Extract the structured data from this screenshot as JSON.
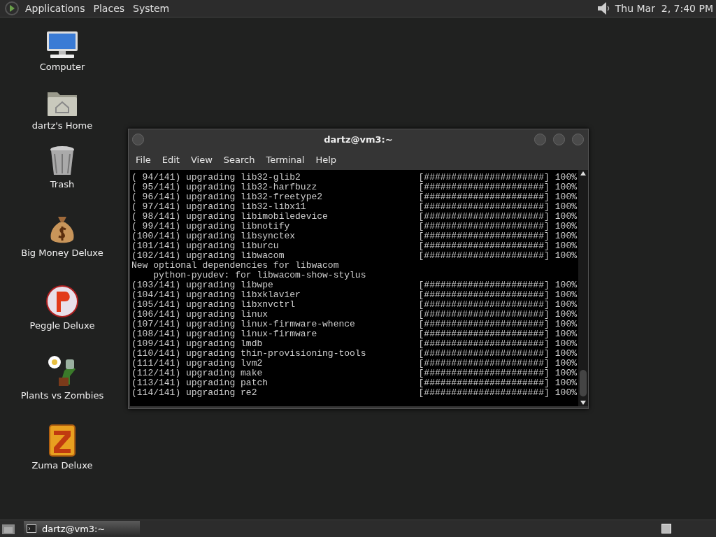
{
  "top_panel": {
    "menus": [
      "Applications",
      "Places",
      "System"
    ],
    "clock": "Thu Mar  2, 7:40 PM"
  },
  "desktop_icons": [
    {
      "kind": "computer",
      "label": "Computer"
    },
    {
      "kind": "home",
      "label": "dartz's Home"
    },
    {
      "kind": "trash",
      "label": "Trash"
    },
    {
      "kind": "money",
      "label": "Big Money Deluxe"
    },
    {
      "kind": "peggle",
      "label": "Peggle Deluxe"
    },
    {
      "kind": "plants",
      "label": "Plants vs Zombies"
    },
    {
      "kind": "zuma",
      "label": "Zuma Deluxe"
    }
  ],
  "window": {
    "title": "dartz@vm3:~",
    "menu": [
      "File",
      "Edit",
      "View",
      "Search",
      "Terminal",
      "Help"
    ],
    "lines": [
      {
        "kind": "progress",
        "text": "( 94/141) upgrading lib32-glib2",
        "bar": "[######################]",
        "percent": "100%"
      },
      {
        "kind": "progress",
        "text": "( 95/141) upgrading lib32-harfbuzz",
        "bar": "[######################]",
        "percent": "100%"
      },
      {
        "kind": "progress",
        "text": "( 96/141) upgrading lib32-freetype2",
        "bar": "[######################]",
        "percent": "100%"
      },
      {
        "kind": "progress",
        "text": "( 97/141) upgrading lib32-libx11",
        "bar": "[######################]",
        "percent": "100%"
      },
      {
        "kind": "progress",
        "text": "( 98/141) upgrading libimobiledevice",
        "bar": "[######################]",
        "percent": "100%"
      },
      {
        "kind": "progress",
        "text": "( 99/141) upgrading libnotify",
        "bar": "[######################]",
        "percent": "100%"
      },
      {
        "kind": "progress",
        "text": "(100/141) upgrading libsynctex",
        "bar": "[######################]",
        "percent": "100%"
      },
      {
        "kind": "progress",
        "text": "(101/141) upgrading liburcu",
        "bar": "[######################]",
        "percent": "100%"
      },
      {
        "kind": "progress",
        "text": "(102/141) upgrading libwacom",
        "bar": "[######################]",
        "percent": "100%"
      },
      {
        "kind": "text",
        "text": "New optional dependencies for libwacom"
      },
      {
        "kind": "text",
        "text": "    python-pyudev: for libwacom-show-stylus"
      },
      {
        "kind": "progress",
        "text": "(103/141) upgrading libwpe",
        "bar": "[######################]",
        "percent": "100%"
      },
      {
        "kind": "progress",
        "text": "(104/141) upgrading libxklavier",
        "bar": "[######################]",
        "percent": "100%"
      },
      {
        "kind": "progress",
        "text": "(105/141) upgrading libxnvctrl",
        "bar": "[######################]",
        "percent": "100%"
      },
      {
        "kind": "progress",
        "text": "(106/141) upgrading linux",
        "bar": "[######################]",
        "percent": "100%"
      },
      {
        "kind": "progress",
        "text": "(107/141) upgrading linux-firmware-whence",
        "bar": "[######################]",
        "percent": "100%"
      },
      {
        "kind": "progress",
        "text": "(108/141) upgrading linux-firmware",
        "bar": "[######################]",
        "percent": "100%"
      },
      {
        "kind": "progress",
        "text": "(109/141) upgrading lmdb",
        "bar": "[######################]",
        "percent": "100%"
      },
      {
        "kind": "progress",
        "text": "(110/141) upgrading thin-provisioning-tools",
        "bar": "[######################]",
        "percent": "100%"
      },
      {
        "kind": "progress",
        "text": "(111/141) upgrading lvm2",
        "bar": "[######################]",
        "percent": "100%"
      },
      {
        "kind": "progress",
        "text": "(112/141) upgrading make",
        "bar": "[######################]",
        "percent": "100%"
      },
      {
        "kind": "progress",
        "text": "(113/141) upgrading patch",
        "bar": "[######################]",
        "percent": "100%"
      },
      {
        "kind": "progress",
        "text": "(114/141) upgrading re2",
        "bar": "[######################]",
        "percent": "100%"
      }
    ]
  },
  "taskbar": {
    "tasks": [
      {
        "label": "dartz@vm3:~",
        "selected": true
      }
    ]
  }
}
